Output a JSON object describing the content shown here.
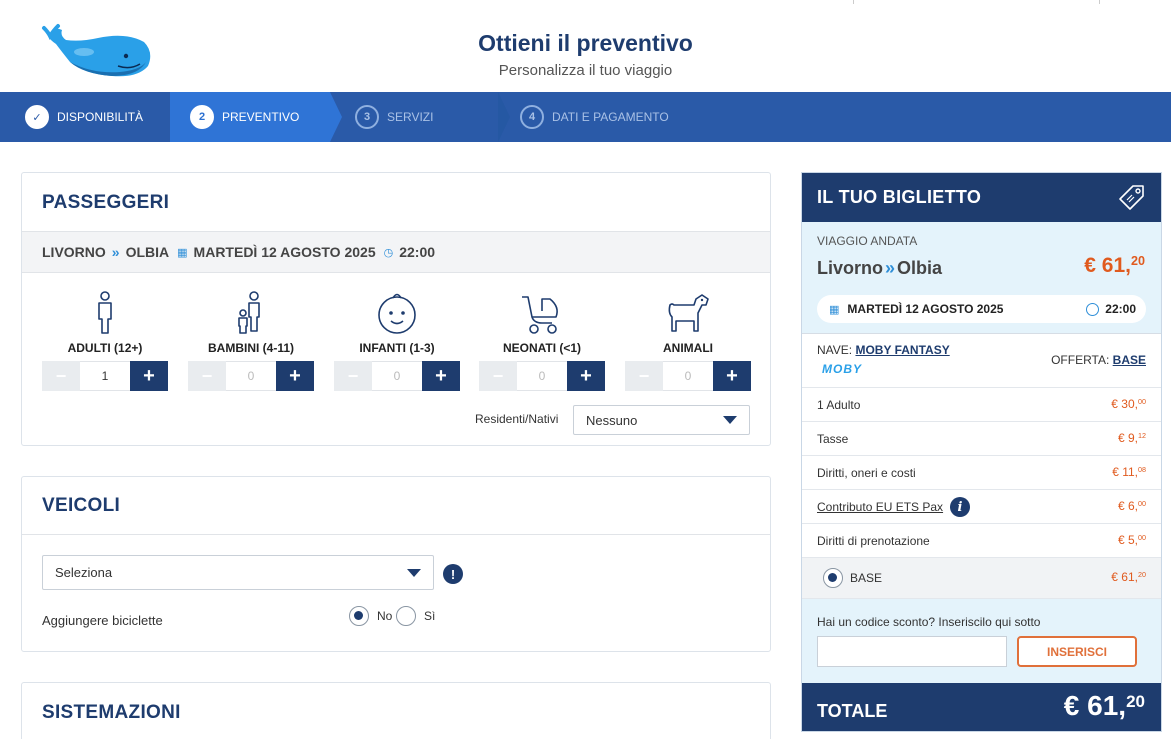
{
  "header": {
    "title": "Ottieni il preventivo",
    "subtitle": "Personalizza il tuo viaggio"
  },
  "steps": [
    {
      "num": "✓",
      "label": "DISPONIBILITÀ",
      "state": "done"
    },
    {
      "num": "2",
      "label": "PREVENTIVO",
      "state": "active"
    },
    {
      "num": "3",
      "label": "SERVIZI",
      "state": "todo"
    },
    {
      "num": "4",
      "label": "DATI E PAGAMENTO",
      "state": "todo"
    }
  ],
  "passeggeri": {
    "title": "PASSEGGERI",
    "route": {
      "from": "LIVORNO",
      "to": "OLBIA",
      "date": "MARTEDÌ 12 AGOSTO 2025",
      "time": "22:00"
    },
    "types": [
      {
        "label": "ADULTI (12+)",
        "icon": "adult-icon",
        "value": "1"
      },
      {
        "label": "BAMBINI (4-11)",
        "icon": "child-icon",
        "value": "0"
      },
      {
        "label": "INFANTI (1-3)",
        "icon": "infant-face-icon",
        "value": "0"
      },
      {
        "label": "NEONATI (<1)",
        "icon": "stroller-icon",
        "value": "0"
      },
      {
        "label": "ANIMALI",
        "icon": "dog-icon",
        "value": "0"
      }
    ],
    "minus": "−",
    "plus": "+",
    "residenti_label": "Residenti/Nativi",
    "residenti_value": "Nessuno"
  },
  "veicoli": {
    "title": "VEICOLI",
    "select_value": "Seleziona",
    "warn": "!",
    "bici_label": "Aggiungere biciclette",
    "no_label": "No",
    "si_label": "Sì",
    "selected": "No"
  },
  "sistemazioni": {
    "title": "SISTEMAZIONI"
  },
  "ticket": {
    "title": "IL TUO BIGLIETTO",
    "viaggio_label": "VIAGGIO ANDATA",
    "from": "Livorno",
    "to": "Olbia",
    "price_int": "€ 61,",
    "price_dec": "20",
    "date": "MARTEDÌ 12 AGOSTO 2025",
    "time": "22:00",
    "nave_label": "NAVE:",
    "nave_name": "MOBY FANTASY",
    "moby_logo": "MOBY",
    "offerta_label": "OFFERTA:",
    "offerta_name": "BASE",
    "rows": [
      {
        "label": "1 Adulto",
        "int": "€ 30,",
        "dec": "00"
      },
      {
        "label": "Tasse",
        "int": "€ 9,",
        "dec": "12"
      },
      {
        "label": "Diritti, oneri e costi",
        "int": "€ 11,",
        "dec": "08"
      },
      {
        "label": "Contributo EU ETS Pax",
        "int": "€ 6,",
        "dec": "00"
      },
      {
        "label": "Diritti di prenotazione",
        "int": "€ 5,",
        "dec": "00"
      }
    ],
    "info": "i",
    "base_label": "BASE",
    "base_int": "€ 61,",
    "base_dec": "20",
    "sconto_label": "Hai un codice sconto? Inseriscilo qui sotto",
    "sconto_button": "INSERISCI",
    "totale_label": "TOTALE",
    "totale_int": "€ 61,",
    "totale_dec": "20"
  },
  "colors": {
    "navy": "#1e3c6e",
    "accent": "#2a5aa8",
    "price": "#e05a1e",
    "light_blue": "#e4f3fb"
  }
}
